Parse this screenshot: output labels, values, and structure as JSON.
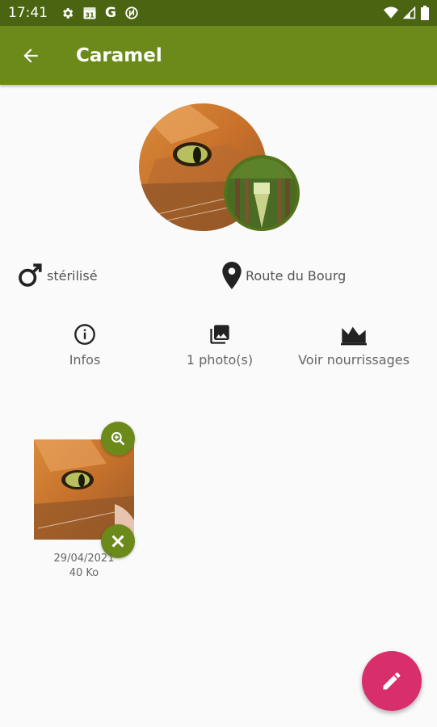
{
  "status_bar": {
    "time": "17:41",
    "calendar_day": "31",
    "google_letter": "G",
    "icons": [
      "gear-icon",
      "calendar-icon",
      "google-icon",
      "no-disturb-icon",
      "wifi-icon",
      "signal-icon",
      "battery-icon"
    ]
  },
  "app_bar": {
    "title": "Caramel",
    "back_icon": "arrow-back-icon",
    "color": "#6b8a1a",
    "status_color": "#4b6412"
  },
  "profile": {
    "gender_icon": "male-symbol-icon",
    "gender_status": "stérilisé",
    "location_icon": "map-pin-icon",
    "location": "Route du Bourg"
  },
  "actions": [
    {
      "icon": "info-icon",
      "label": "Infos"
    },
    {
      "icon": "photo-library-icon",
      "label": "1 photo(s)"
    },
    {
      "icon": "area-chart-icon",
      "label": "Voir nourrissages"
    }
  ],
  "photos": [
    {
      "date": "29/04/2021",
      "size": "40 Ko",
      "zoom_icon": "zoom-in-icon",
      "delete_icon": "close-icon"
    }
  ],
  "fab": {
    "icon": "pencil-icon",
    "color": "#d92e6c"
  }
}
